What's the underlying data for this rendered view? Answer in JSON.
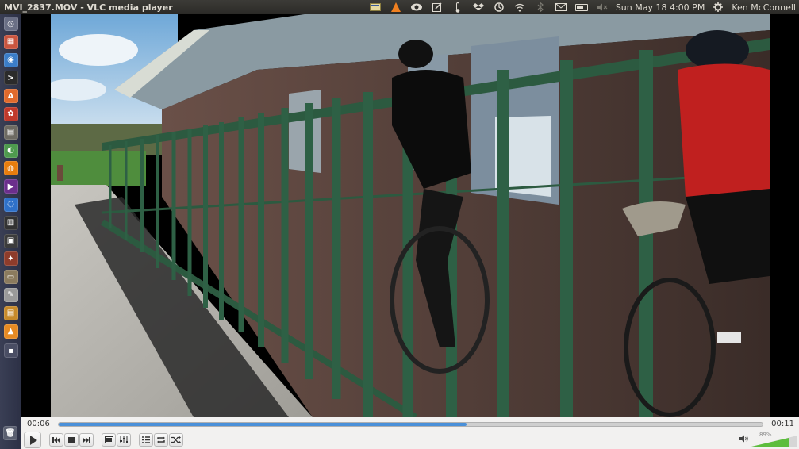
{
  "window": {
    "title": "MVI_2837.MOV - VLC media player"
  },
  "top_panel": {
    "datetime": "Sun May 18  4:00 PM",
    "user": "Ken McConnell"
  },
  "player": {
    "time_elapsed": "00:06",
    "time_total": "00:11",
    "progress_fraction": 0.578,
    "volume_text": "89%",
    "volume_fraction": 0.89
  },
  "launcher": {
    "items": [
      {
        "icon": "dash-home-icon",
        "color": "#6a6f85",
        "glyph": "◎"
      },
      {
        "icon": "calendar-app-icon",
        "color": "#c9553f",
        "glyph": "▦"
      },
      {
        "icon": "browser-icon",
        "color": "#3b7dc9",
        "glyph": "◉"
      },
      {
        "icon": "terminal-icon",
        "color": "#2b2b2b",
        "glyph": ">"
      },
      {
        "icon": "software-center-icon",
        "color": "#e16a2c",
        "glyph": "A"
      },
      {
        "icon": "system-settings-icon",
        "color": "#c0392b",
        "glyph": "✿"
      },
      {
        "icon": "text-editor-icon",
        "color": "#6d6a62",
        "glyph": "▤"
      },
      {
        "icon": "eclipse-app-icon",
        "color": "#4e9a4e",
        "glyph": "◐"
      },
      {
        "icon": "blender-icon",
        "color": "#e87d0d",
        "glyph": "◍"
      },
      {
        "icon": "media-app-icon",
        "color": "#6b2f8c",
        "glyph": "▶"
      },
      {
        "icon": "network-app-icon",
        "color": "#2f71c9",
        "glyph": "◌"
      },
      {
        "icon": "system-monitor-icon",
        "color": "#333333",
        "glyph": "▥"
      },
      {
        "icon": "monitor-app-icon",
        "color": "#3c3c3c",
        "glyph": "▣"
      },
      {
        "icon": "image-viewer-icon",
        "color": "#8e3c2b",
        "glyph": "✦"
      },
      {
        "icon": "files-app-icon",
        "color": "#8b7b5e",
        "glyph": "▭"
      },
      {
        "icon": "video-editor-icon",
        "color": "#9a9a9a",
        "glyph": "✎"
      },
      {
        "icon": "archive-icon",
        "color": "#c78a2a",
        "glyph": "▤"
      },
      {
        "icon": "vlc-launcher-icon",
        "color": "#e68a23",
        "glyph": "▲"
      },
      {
        "icon": "workspace-icon",
        "color": "#4a4e64",
        "glyph": "▪"
      }
    ]
  }
}
